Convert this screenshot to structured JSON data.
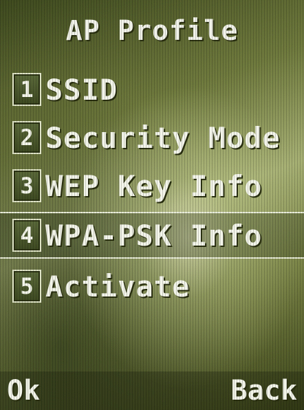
{
  "header": {
    "title": "AP Profile"
  },
  "menu": {
    "items": [
      {
        "number": "1",
        "label": "SSID",
        "selected": false
      },
      {
        "number": "2",
        "label": "Security Mode",
        "selected": false
      },
      {
        "number": "3",
        "label": "WEP Key Info",
        "selected": false
      },
      {
        "number": "4",
        "label": "WPA-PSK Info",
        "selected": true
      },
      {
        "number": "5",
        "label": "Activate",
        "selected": false
      }
    ]
  },
  "softkeys": {
    "left": "Ok",
    "right": "Back"
  }
}
